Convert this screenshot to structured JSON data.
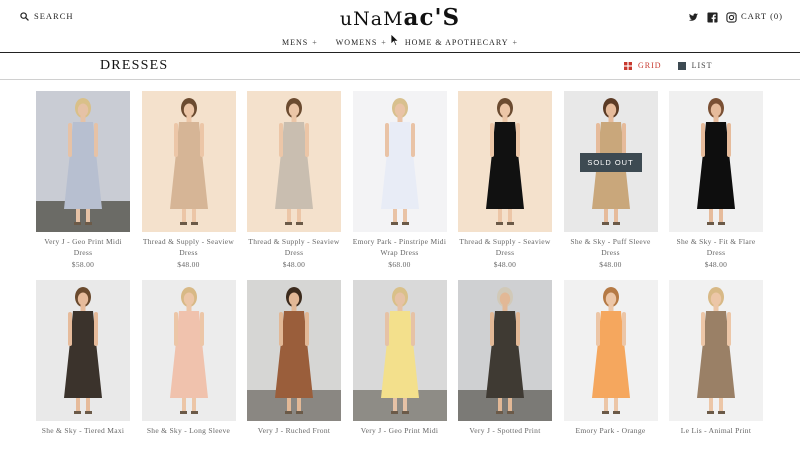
{
  "header": {
    "search_label": "SEARCH",
    "logo_a": "uNaM",
    "logo_b": "ac'S",
    "cart_label": "CART (0)",
    "social": [
      "twitter-icon",
      "facebook-icon",
      "instagram-icon"
    ]
  },
  "nav": {
    "items": [
      {
        "label": "MENS",
        "plus": "+"
      },
      {
        "label": "WOMENS",
        "plus": "+"
      },
      {
        "label": "HOME & APOTHECARY",
        "plus": "+"
      }
    ]
  },
  "collection": {
    "title": "DRESSES",
    "grid_label": "GRID",
    "list_label": "LIST",
    "active_view": "grid",
    "accent_color": "#c8382e"
  },
  "products": [
    {
      "name": "Very J - Geo Print Midi Dress",
      "price": "$58.00",
      "bg": "#c9ccd4",
      "floor": "#6b6b66",
      "dress": "#b7bfd0",
      "skin": "#e6c2a6",
      "hair": "#d9c089"
    },
    {
      "name": "Thread & Supply - Seaview Dress",
      "price": "$48.00",
      "bg": "#f4e1cc",
      "floor": "#f4e1cc",
      "dress": "#d6b596",
      "skin": "#ecc6a7",
      "hair": "#6b4b30"
    },
    {
      "name": "Thread & Supply - Seaview Dress",
      "price": "$48.00",
      "bg": "#f4e1cc",
      "floor": "#f4e1cc",
      "dress": "#c9beb0",
      "skin": "#ecc6a7",
      "hair": "#6b4b30"
    },
    {
      "name": "Emory Park - Pinstripe Midi Wrap Dress",
      "price": "$68.00",
      "bg": "#f3f3f5",
      "floor": "#f3f3f5",
      "dress": "#e8ecf6",
      "skin": "#e9c3a6",
      "hair": "#d8c08e"
    },
    {
      "name": "Thread & Supply - Seaview Dress",
      "price": "$48.00",
      "bg": "#f4e1cc",
      "floor": "#f4e1cc",
      "dress": "#111111",
      "skin": "#ecc6a7",
      "hair": "#6b4b30"
    },
    {
      "name": "She & Sky - Puff Sleeve Dress",
      "price": "$48.00",
      "bg": "#e8e8e8",
      "floor": "#e8e8e8",
      "dress": "#c9a77b",
      "skin": "#e6bb9b",
      "hair": "#5b3b25",
      "sold_out": "SOLD OUT"
    },
    {
      "name": "She & Sky - Fit & Flare Dress",
      "price": "$48.00",
      "bg": "#f0f0f0",
      "floor": "#f0f0f0",
      "dress": "#0e0e0e",
      "skin": "#e6bb9b",
      "hair": "#7a5034"
    },
    {
      "name": "She & Sky - Tiered Maxi",
      "price": "",
      "bg": "#e9e9e9",
      "floor": "#e9e9e9",
      "dress": "#3b332c",
      "skin": "#e6bb9b",
      "hair": "#6a4a2e"
    },
    {
      "name": "She & Sky - Long Sleeve",
      "price": "",
      "bg": "#ececec",
      "floor": "#ececec",
      "dress": "#f0c2ad",
      "skin": "#ecc6a7",
      "hair": "#d8b986"
    },
    {
      "name": "Very J - Ruched Front",
      "price": "",
      "bg": "#d6d6d4",
      "floor": "#8a8782",
      "dress": "#9a5e3b",
      "skin": "#e2b896",
      "hair": "#3c2b1d"
    },
    {
      "name": "Very J - Geo Print Midi",
      "price": "",
      "bg": "#d9d9d9",
      "floor": "#8e8c86",
      "dress": "#f3e08c",
      "skin": "#e6c2a6",
      "hair": "#d9c089"
    },
    {
      "name": "Very J - Spotted Print",
      "price": "",
      "bg": "#cfd0d2",
      "floor": "#7b7a76",
      "dress": "#3f3a33",
      "skin": "#e2b896",
      "hair": "#d1c9b8"
    },
    {
      "name": "Emory Park - Orange",
      "price": "",
      "bg": "#f1f1f1",
      "floor": "#f1f1f1",
      "dress": "#f5a75e",
      "skin": "#ecc6a7",
      "hair": "#b57a45"
    },
    {
      "name": "Le Lis - Animal Print",
      "price": "",
      "bg": "#f1f1f1",
      "floor": "#f1f1f1",
      "dress": "#9a8066",
      "skin": "#ecc6a7",
      "hair": "#d8b986"
    }
  ]
}
